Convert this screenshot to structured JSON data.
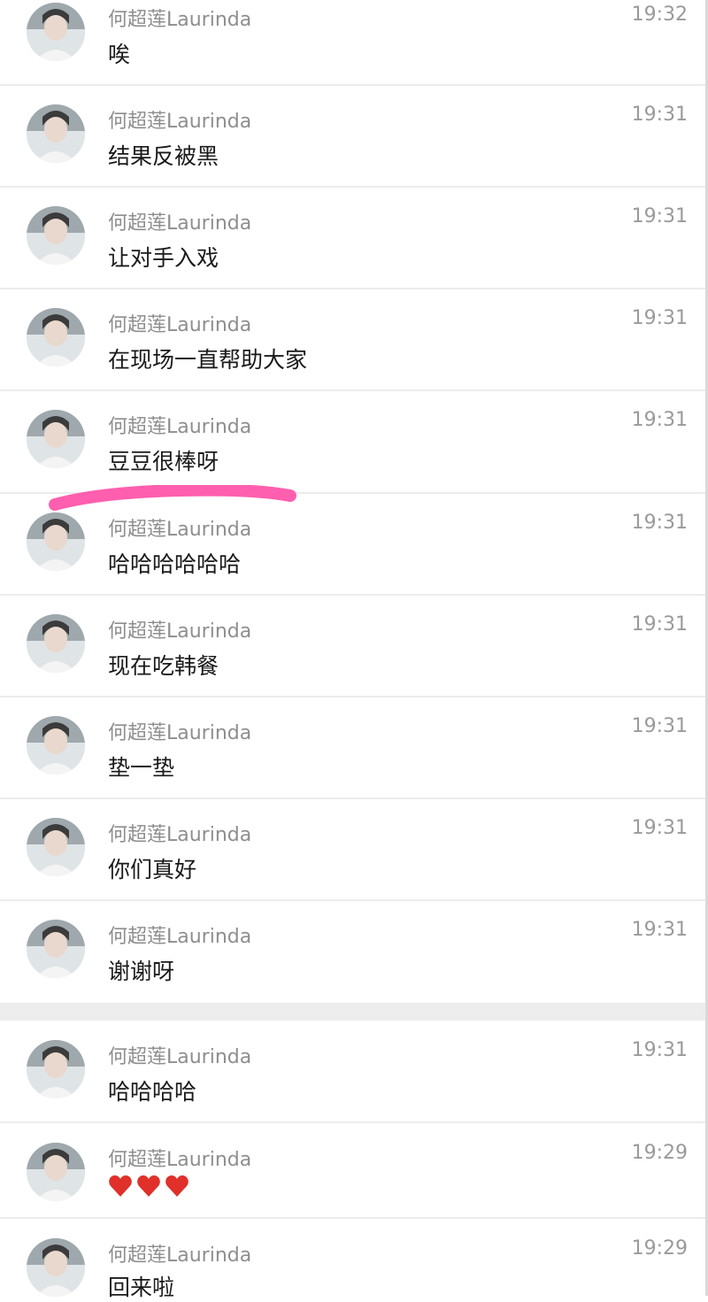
{
  "sender": "何超莲Laurinda",
  "messages": [
    {
      "time": "19:32",
      "text": "唉"
    },
    {
      "time": "19:31",
      "text": "结果反被黑"
    },
    {
      "time": "19:31",
      "text": "让对手入戏"
    },
    {
      "time": "19:31",
      "text": "在现场一直帮助大家"
    },
    {
      "time": "19:31",
      "text": "豆豆很棒呀"
    },
    {
      "time": "19:31",
      "text": "哈哈哈哈哈哈"
    },
    {
      "time": "19:31",
      "text": "现在吃韩餐"
    },
    {
      "time": "19:31",
      "text": "垫一垫"
    },
    {
      "time": "19:31",
      "text": "你们真好"
    },
    {
      "time": "19:31",
      "text": "谢谢呀"
    },
    {
      "time": "19:31",
      "text": "哈哈哈哈"
    },
    {
      "time": "19:29",
      "text": "",
      "emoji": "heart-emoji x3"
    },
    {
      "time": "19:29",
      "text": "回来啦"
    }
  ],
  "colors": {
    "highlight": "#ff5fae",
    "heart": "#e0302a",
    "name": "#8e8e8e"
  }
}
